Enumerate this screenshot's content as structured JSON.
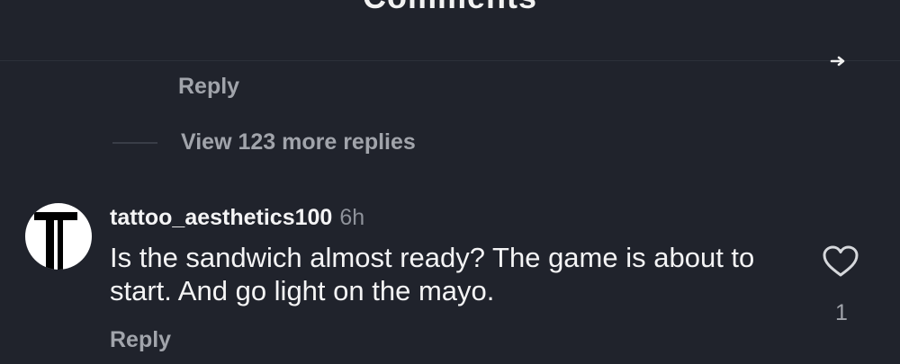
{
  "header": {
    "title": "Comments"
  },
  "thread": {
    "reply_label": "Reply",
    "view_more_label": "View 123 more replies"
  },
  "comment": {
    "avatar_letter": "T",
    "username": "tattoo_aesthetics100",
    "timestamp": "6h",
    "text": "Is the sandwich almost ready? The game is about to start. And go light on the mayo.",
    "like_count": "1",
    "reply_label": "Reply"
  },
  "icons": {
    "corner": "reply-arrow-icon",
    "like": "heart-outline-icon"
  },
  "colors": {
    "background": "#20232c",
    "primary_text": "#f4f4f5",
    "secondary_text": "#a1a4ab"
  }
}
